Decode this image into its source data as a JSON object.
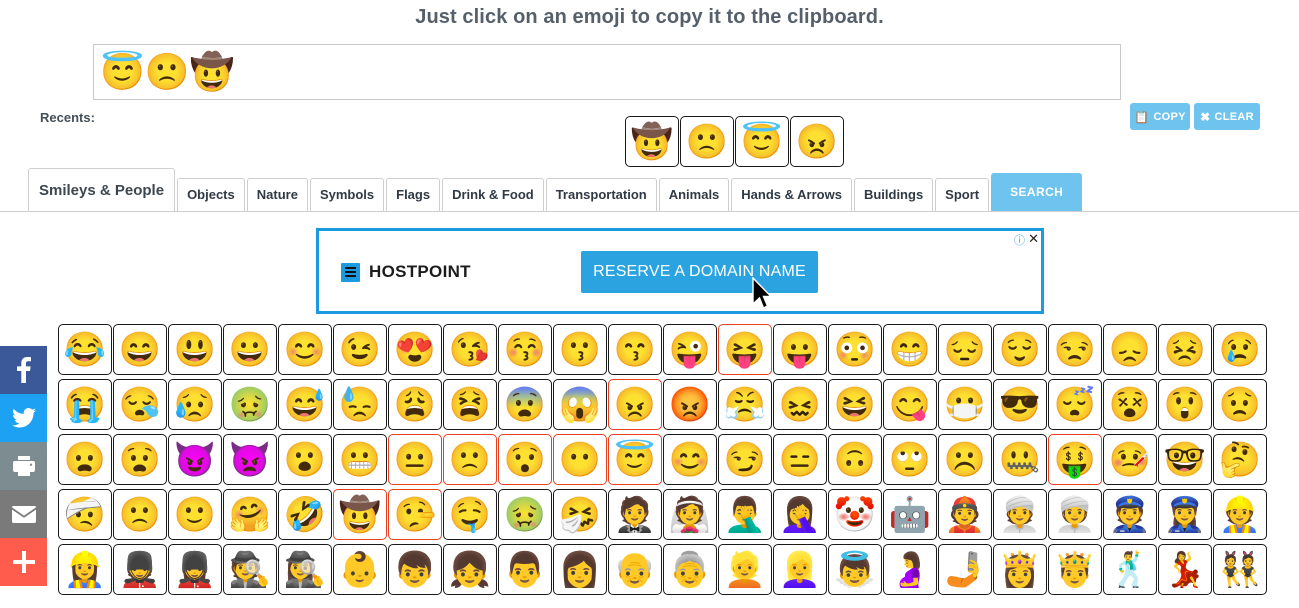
{
  "page": {
    "title": "Just click on an emoji to copy it to the clipboard.",
    "recents_label": "Recents:"
  },
  "colors": {
    "accent_blue": "#6ec3ef",
    "ad_blue": "#1b9ae0",
    "selected_border": "#e8401f",
    "facebook": "#3b5998",
    "twitter": "#1da1f2",
    "print": "#7d8c91",
    "email": "#7a7a7a",
    "plus": "#ff5c4d"
  },
  "input": {
    "value_emojis": [
      "😇",
      "🙁",
      "🤠"
    ],
    "copy_label": "COPY",
    "clear_label": "CLEAR",
    "copy_icon": "clipboard-icon",
    "clear_icon": "times-icon"
  },
  "recents": [
    "🤠",
    "🙁",
    "😇",
    "😠"
  ],
  "tabs": [
    {
      "label": "Smileys & People",
      "active": true,
      "kind": "tab"
    },
    {
      "label": "Objects",
      "active": false,
      "kind": "tab"
    },
    {
      "label": "Nature",
      "active": false,
      "kind": "tab"
    },
    {
      "label": "Symbols",
      "active": false,
      "kind": "tab"
    },
    {
      "label": "Flags",
      "active": false,
      "kind": "tab"
    },
    {
      "label": "Drink & Food",
      "active": false,
      "kind": "tab"
    },
    {
      "label": "Transportation",
      "active": false,
      "kind": "tab"
    },
    {
      "label": "Animals",
      "active": false,
      "kind": "tab"
    },
    {
      "label": "Hands & Arrows",
      "active": false,
      "kind": "tab"
    },
    {
      "label": "Buildings",
      "active": false,
      "kind": "tab"
    },
    {
      "label": "Sport",
      "active": false,
      "kind": "tab"
    },
    {
      "label": "SEARCH",
      "active": false,
      "kind": "search"
    }
  ],
  "ad": {
    "brand": "HOSTPOINT",
    "cta_label": "RESERVE A DOMAIN NAME",
    "adchoices_icon": "info-circle-icon",
    "close_icon": "close-icon",
    "close_label": "✕",
    "adchoices_label": "ⓘ",
    "logo_icon": "hostpoint-logo-icon",
    "cursor_icon": "mouse-pointer-icon"
  },
  "share": [
    {
      "name": "facebook",
      "color": "#3b5998",
      "icon": "facebook-icon"
    },
    {
      "name": "twitter",
      "color": "#1da1f2",
      "icon": "twitter-icon"
    },
    {
      "name": "print",
      "color": "#7d8c91",
      "icon": "printer-icon"
    },
    {
      "name": "email",
      "color": "#7a7a7a",
      "icon": "envelope-icon"
    },
    {
      "name": "more",
      "color": "#ff5c4d",
      "icon": "plus-icon"
    }
  ],
  "emoji_grid": {
    "rows": [
      [
        {
          "e": "😂",
          "s": false
        },
        {
          "e": "😄",
          "s": false
        },
        {
          "e": "😃",
          "s": false
        },
        {
          "e": "😀",
          "s": false
        },
        {
          "e": "😊",
          "s": false
        },
        {
          "e": "😉",
          "s": false
        },
        {
          "e": "😍",
          "s": false
        },
        {
          "e": "😘",
          "s": false
        },
        {
          "e": "😚",
          "s": false
        },
        {
          "e": "😗",
          "s": false
        },
        {
          "e": "😙",
          "s": false
        },
        {
          "e": "😜",
          "s": false
        },
        {
          "e": "😝",
          "s": true
        },
        {
          "e": "😛",
          "s": false
        },
        {
          "e": "😳",
          "s": false
        },
        {
          "e": "😁",
          "s": false
        },
        {
          "e": "😔",
          "s": false
        },
        {
          "e": "😌",
          "s": false
        },
        {
          "e": "😒",
          "s": false
        },
        {
          "e": "😞",
          "s": false
        },
        {
          "e": "😣",
          "s": false
        },
        {
          "e": "😢",
          "s": false
        }
      ],
      [
        {
          "e": "😭",
          "s": false
        },
        {
          "e": "😪",
          "s": false
        },
        {
          "e": "😥",
          "s": false
        },
        {
          "e": "🤢",
          "s": false
        },
        {
          "e": "😅",
          "s": false
        },
        {
          "e": "😓",
          "s": false
        },
        {
          "e": "😩",
          "s": false
        },
        {
          "e": "😫",
          "s": false
        },
        {
          "e": "😨",
          "s": false
        },
        {
          "e": "😱",
          "s": false
        },
        {
          "e": "😠",
          "s": true
        },
        {
          "e": "😡",
          "s": false
        },
        {
          "e": "😤",
          "s": false
        },
        {
          "e": "😖",
          "s": false
        },
        {
          "e": "😆",
          "s": false
        },
        {
          "e": "😋",
          "s": false
        },
        {
          "e": "😷",
          "s": false
        },
        {
          "e": "😎",
          "s": false
        },
        {
          "e": "😴",
          "s": false
        },
        {
          "e": "😵",
          "s": false
        },
        {
          "e": "😲",
          "s": false
        },
        {
          "e": "😟",
          "s": false
        }
      ],
      [
        {
          "e": "😦",
          "s": false
        },
        {
          "e": "😧",
          "s": false
        },
        {
          "e": "😈",
          "s": false
        },
        {
          "e": "👿",
          "s": false
        },
        {
          "e": "😮",
          "s": false
        },
        {
          "e": "😬",
          "s": false
        },
        {
          "e": "😐",
          "s": true
        },
        {
          "e": "🙁",
          "s": true
        },
        {
          "e": "😯",
          "s": true
        },
        {
          "e": "😶",
          "s": true
        },
        {
          "e": "😇",
          "s": true
        },
        {
          "e": "😊",
          "s": false
        },
        {
          "e": "😏",
          "s": false
        },
        {
          "e": "😑",
          "s": false
        },
        {
          "e": "🙃",
          "s": false
        },
        {
          "e": "🙄",
          "s": false
        },
        {
          "e": "☹️",
          "s": false
        },
        {
          "e": "🤐",
          "s": false
        },
        {
          "e": "🤑",
          "s": true
        },
        {
          "e": "🤒",
          "s": false
        },
        {
          "e": "🤓",
          "s": false
        },
        {
          "e": "🤔",
          "s": false
        }
      ],
      [
        {
          "e": "🤕",
          "s": false
        },
        {
          "e": "🙁",
          "s": false
        },
        {
          "e": "🙂",
          "s": false
        },
        {
          "e": "🤗",
          "s": false
        },
        {
          "e": "🤣",
          "s": false
        },
        {
          "e": "🤠",
          "s": true
        },
        {
          "e": "🤥",
          "s": true
        },
        {
          "e": "🤤",
          "s": false
        },
        {
          "e": "🤢",
          "s": false
        },
        {
          "e": "🤧",
          "s": false
        },
        {
          "e": "🤵",
          "s": false
        },
        {
          "e": "👰",
          "s": false
        },
        {
          "e": "🤦‍♂️",
          "s": false
        },
        {
          "e": "🤦‍♀️",
          "s": false
        },
        {
          "e": "🤡",
          "s": false
        },
        {
          "e": "🤖",
          "s": false
        },
        {
          "e": "👲",
          "s": false
        },
        {
          "e": "👳",
          "s": false
        },
        {
          "e": "👳‍♀️",
          "s": false
        },
        {
          "e": "👮",
          "s": false
        },
        {
          "e": "👮‍♀️",
          "s": false
        },
        {
          "e": "👷",
          "s": false
        }
      ],
      [
        {
          "e": "👷‍♀️",
          "s": false
        },
        {
          "e": "💂",
          "s": false
        },
        {
          "e": "💂‍♀️",
          "s": false
        },
        {
          "e": "🕵️",
          "s": false
        },
        {
          "e": "🕵️‍♀️",
          "s": false
        },
        {
          "e": "👶",
          "s": false
        },
        {
          "e": "👦",
          "s": false
        },
        {
          "e": "👧",
          "s": false
        },
        {
          "e": "👨",
          "s": false
        },
        {
          "e": "👩",
          "s": false
        },
        {
          "e": "👴",
          "s": false
        },
        {
          "e": "👵",
          "s": false
        },
        {
          "e": "👱",
          "s": false
        },
        {
          "e": "👱‍♀️",
          "s": false
        },
        {
          "e": "👼",
          "s": false
        },
        {
          "e": "🤰",
          "s": false
        },
        {
          "e": "🤳",
          "s": false
        },
        {
          "e": "👸",
          "s": false
        },
        {
          "e": "🤴",
          "s": false
        },
        {
          "e": "🕺",
          "s": false
        },
        {
          "e": "💃",
          "s": false
        },
        {
          "e": "👯",
          "s": false
        }
      ]
    ]
  }
}
